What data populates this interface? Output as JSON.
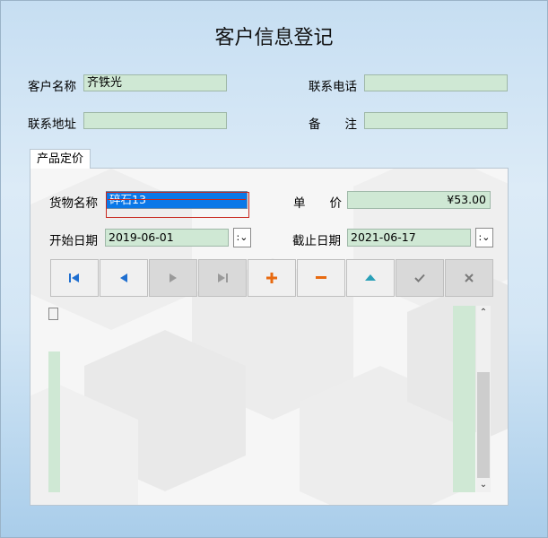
{
  "window": {
    "title": "客户信息登记"
  },
  "customer": {
    "name_label": "客户名称",
    "name_value": "齐铁光",
    "phone_label": "联系电话",
    "phone_value": "",
    "address_label": "联系地址",
    "address_value": "",
    "note_label": "备　　注",
    "note_value": ""
  },
  "tabs": [
    {
      "label": "产品定价",
      "active": true
    }
  ],
  "pricing": {
    "goods_label": "货物名称",
    "goods_value": "碎石13",
    "price_label": "单　　价",
    "price_value": "¥53.00",
    "start_label": "开始日期",
    "start_value": "2019-06-01",
    "end_label": "截止日期",
    "end_value": "2021-06-17"
  },
  "navigator": [
    {
      "name": "first-record",
      "icon": "first-icon",
      "enabled": true
    },
    {
      "name": "prior-record",
      "icon": "prior-icon",
      "enabled": true
    },
    {
      "name": "next-record",
      "icon": "next-icon",
      "enabled": false
    },
    {
      "name": "last-record",
      "icon": "last-icon",
      "enabled": false
    },
    {
      "name": "insert-record",
      "icon": "plus-icon",
      "enabled": true
    },
    {
      "name": "delete-record",
      "icon": "minus-icon",
      "enabled": true
    },
    {
      "name": "edit-record",
      "icon": "up-triangle-icon",
      "enabled": true
    },
    {
      "name": "post-record",
      "icon": "check-icon",
      "enabled": false
    },
    {
      "name": "cancel-record",
      "icon": "x-icon",
      "enabled": false
    }
  ],
  "colors": {
    "field_bg": "#cfe8d4",
    "selection": "#0a78e8",
    "focus_border": "#c8281e",
    "nav_blue": "#1f6fd0",
    "nav_orange": "#e86a10",
    "nav_teal": "#2aa0b8"
  }
}
